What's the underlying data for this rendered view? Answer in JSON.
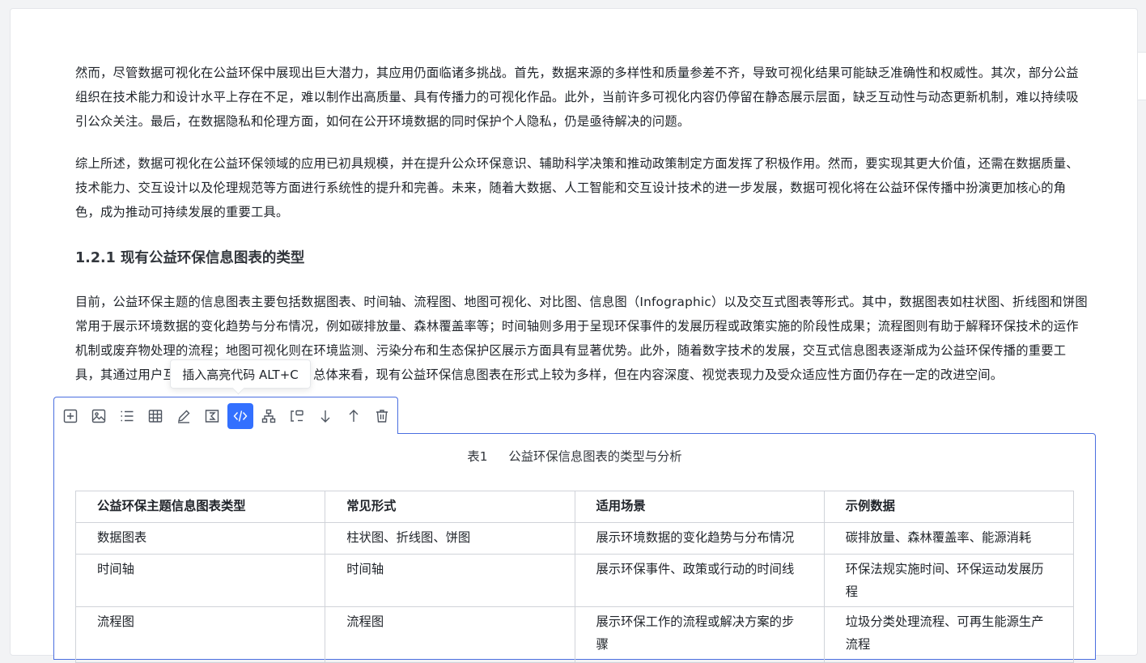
{
  "paragraphs": [
    {
      "lines": [
        "然而，尽管数据可视化在公益环保中展现出巨大潜力，其应用仍面临诸多挑战。首先，数据来源的多样性和质量参差不齐，导致可视化结果可能缺乏准确性和权威性。其次，部分公益",
        "组织在技术能力和设计水平上存在不足，难以制作出高质量、具有传播力的可视化作品。此外，当前许多可视化内容仍停留在静态展示层面，缺乏互动性与动态更新机制，难以持续吸",
        "引公众关注。最后，在数据隐私和伦理方面，如何在公开环境数据的同时保护个人隐私，仍是亟待解决的问题。"
      ]
    },
    {
      "lines": [
        "综上所述，数据可视化在公益环保领域的应用已初具规模，并在提升公众环保意识、辅助科学决策和推动政策制定方面发挥了积极作用。然而，要实现其更大价值，还需在数据质量、",
        "技术能力、交互设计以及伦理规范等方面进行系统性的提升和完善。未来，随着大数据、人工智能和交互设计技术的进一步发展，数据可视化将在公益环保传播中扮演更加核心的角",
        "色，成为推动可持续发展的重要工具。"
      ]
    }
  ],
  "heading": "1.2.1 现有公益环保信息图表的类型",
  "paragraph3": {
    "lines": [
      "目前，公益环保主题的信息图表主要包括数据图表、时间轴、流程图、地图可视化、对比图、信息图（Infographic）以及交互式图表等形式。其中，数据图表如柱状图、折线图和饼图",
      "常用于展示环境数据的变化趋势与分布情况，例如碳排放量、森林覆盖率等；时间轴则多用于呈现环保事件的发展历程或政策实施的阶段性成果；流程图则有助于解释环保技术的运作",
      "机制或废弃物处理的流程；地图可视化则在环境监测、污染分布和生态保护区展示方面具有显著优势。此外，随着数字技术的发展，交互式信息图表逐渐成为公益环保传播的重要工"
    ],
    "last_line_start": "具，其通过用户互",
    "last_line_end": "播效果。总体来看，现有公益环保信息图表在形式上较为多样，但在内容深度、视觉表现力及受众适应性方面仍存在一定的改进空间。"
  },
  "tooltip": "插入高亮代码 ALT+C",
  "toolbar": [
    {
      "icon": "add-block-icon"
    },
    {
      "icon": "image-icon"
    },
    {
      "icon": "list-icon"
    },
    {
      "icon": "table-icon"
    },
    {
      "icon": "pen-icon"
    },
    {
      "icon": "formula-icon"
    },
    {
      "icon": "code-icon",
      "active": true
    },
    {
      "icon": "hierarchy-icon"
    },
    {
      "icon": "flow-icon"
    },
    {
      "icon": "arrow-down-icon"
    },
    {
      "icon": "arrow-up-icon"
    },
    {
      "icon": "trash-icon"
    }
  ],
  "table": {
    "caption_number": "表1",
    "caption_title": "公益环保信息图表的类型与分析",
    "headers": [
      "公益环保主题信息图表类型",
      "常见形式",
      "适用场景",
      "示例数据"
    ],
    "rows": [
      [
        "数据图表",
        "柱状图、折线图、饼图",
        "展示环境数据的变化趋势与分布情况",
        "碳排放量、森林覆盖率、能源消耗"
      ],
      [
        "时间轴",
        "时间轴",
        "展示环保事件、政策或行动的时间线",
        "环保法规实施时间、环保运动发展历程"
      ],
      [
        "流程图",
        "流程图",
        "展示环保工作的流程或解决方案的步骤",
        "垃圾分类处理流程、可再生能源生产流程"
      ]
    ]
  },
  "colors": {
    "accent": "#3370ff",
    "border": "#4a6ee0"
  }
}
